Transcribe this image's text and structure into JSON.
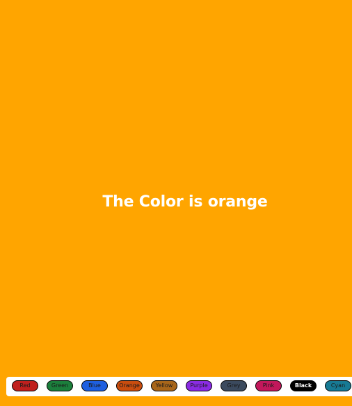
{
  "display": {
    "message": "The Color is orange",
    "background_color": "#FFA500"
  },
  "toolbar": {
    "buttons": [
      {
        "label": "Red",
        "color": "#C0201E"
      },
      {
        "label": "Green",
        "color": "#1B7F3C"
      },
      {
        "label": "Blue",
        "color": "#1E5FE0"
      },
      {
        "label": "Orange",
        "color": "#C94D0F"
      },
      {
        "label": "Yellow",
        "color": "#A8661A"
      },
      {
        "label": "Purple",
        "color": "#8A2BE2"
      },
      {
        "label": "Grey",
        "color": "#3B4A5E"
      },
      {
        "label": "Pink",
        "color": "#C2185B"
      },
      {
        "label": "Black",
        "color": "#000000"
      },
      {
        "label": "Cyan",
        "color": "#177A94"
      }
    ]
  }
}
